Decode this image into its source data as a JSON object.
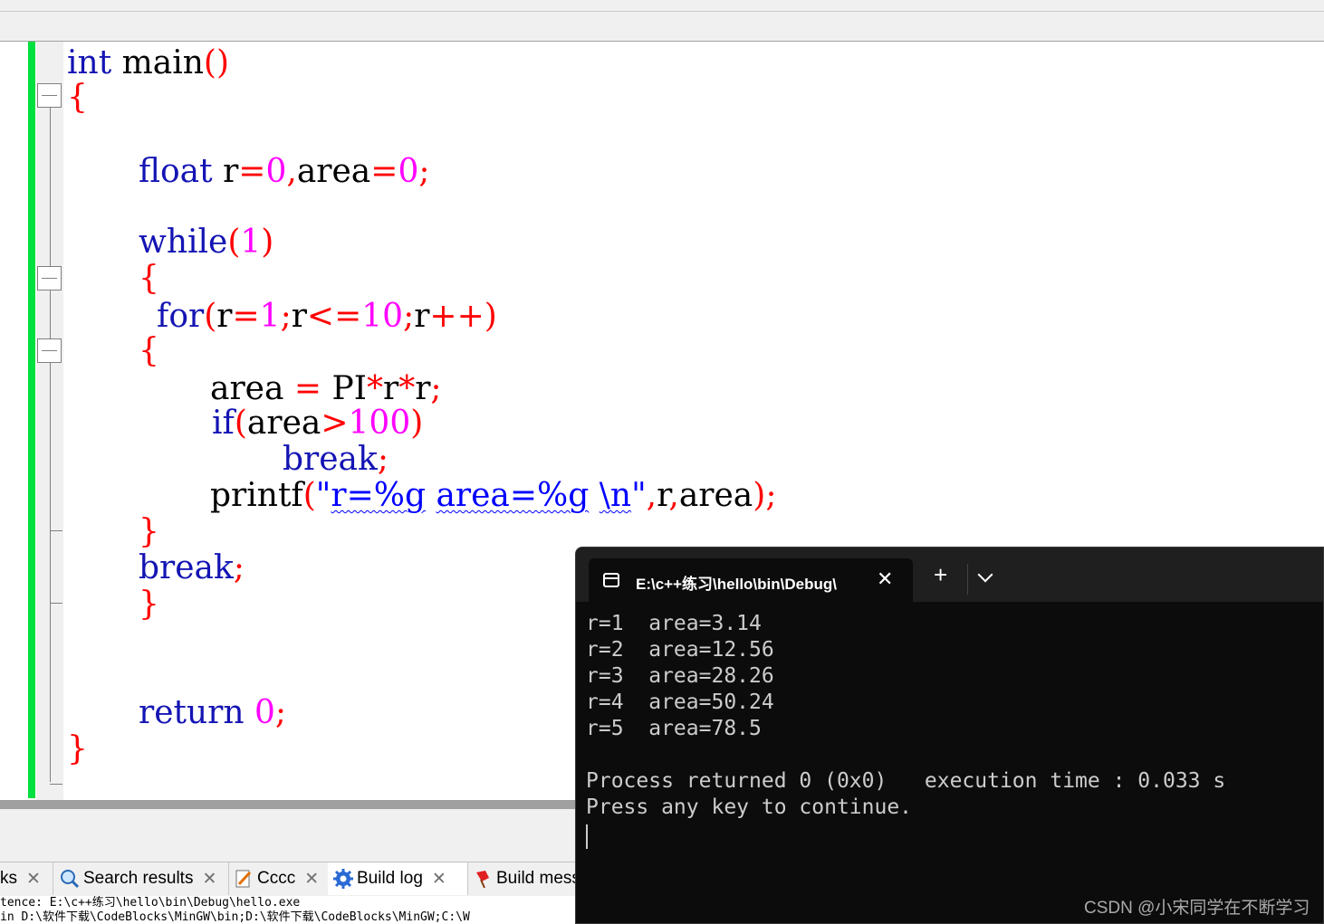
{
  "editor": {
    "lines": {
      "l1": {
        "kw": "int",
        "name": " main",
        "open": "(",
        "close": ")"
      },
      "l2": {
        "brace": "{"
      },
      "l3": {
        "kw": "float",
        "sp": " ",
        "r": "r",
        "eq1": "=",
        "n0a": "0",
        "comma": ",",
        "area": "area",
        "eq2": "=",
        "n0b": "0",
        "semi": ";"
      },
      "l4": {
        "kw": "while",
        "open": "(",
        "n1": "1",
        "close": ")"
      },
      "l5": {
        "brace": "{"
      },
      "l6": {
        "kw": "for",
        "open": "(",
        "r1": "r",
        "eq": "=",
        "n1": "1",
        "s1": ";",
        "r2": "r",
        "le": "<=",
        "n10": "10",
        "s2": ";",
        "r3": "r",
        "pp": "++",
        "close": ")"
      },
      "l7": {
        "brace": "{"
      },
      "l8": {
        "area": "area",
        "sp1": " ",
        "eq": "=",
        "sp2": " ",
        "pi": "PI",
        "m1": "*",
        "r1": "r",
        "m2": "*",
        "r2": "r",
        "semi": ";"
      },
      "l9": {
        "kw": "if",
        "open": "(",
        "area": "area",
        "gt": ">",
        "n100": "100",
        "close": ")"
      },
      "l10": {
        "kw": "break",
        "semi": ";"
      },
      "l11": {
        "fn": "printf",
        "open": "(",
        "q1": "\"",
        "s1": "r=%g",
        "sp1": " ",
        "s2": "area=%g",
        "sp2": " ",
        "s3": "\\n",
        "q2": "\"",
        "c1": ",",
        "r": "r",
        "c2": ",",
        "area": "area",
        "close": ")",
        "semi": ";"
      },
      "l12": {
        "brace": "}"
      },
      "l13": {
        "kw": "break",
        "semi": ";"
      },
      "l14": {
        "brace": "}"
      },
      "l15": {
        "kw": "return",
        "sp": " ",
        "n0": "0",
        "semi": ";"
      },
      "l16": {
        "brace": "}"
      }
    }
  },
  "bottom_panel": {
    "tabs": [
      {
        "label": "ks",
        "close": "✕"
      },
      {
        "label": "Search results",
        "close": "✕"
      },
      {
        "label": "Cccc",
        "close": "✕"
      },
      {
        "label": "Build log",
        "close": "✕"
      },
      {
        "label": "Build mess",
        "close": ""
      }
    ],
    "log_lines": [
      "tence: E:\\c++练习\\hello\\bin\\Debug\\hello.exe",
      "in  D:\\软件下载\\CodeBlocks\\MinGW\\bin;D:\\软件下载\\CodeBlocks\\MinGW;C:\\W"
    ]
  },
  "terminal": {
    "tab_title": "E:\\c++练习\\hello\\bin\\Debug\\",
    "close_glyph": "✕",
    "plus_glyph": "+",
    "output": [
      "r=1  area=3.14",
      "r=2  area=12.56",
      "r=3  area=28.26",
      "r=4  area=50.24",
      "r=5  area=78.5",
      "",
      "Process returned 0 (0x0)   execution time : 0.033 s",
      "Press any key to continue."
    ]
  },
  "watermark": "CSDN @小宋同学在不断学习",
  "colors": {
    "keyword": "#1414b4",
    "operator": "#ff0000",
    "number": "#ff00ff",
    "string": "#0000ff",
    "changebar": "#00e040",
    "terminal_bg": "#0c0c0c"
  }
}
